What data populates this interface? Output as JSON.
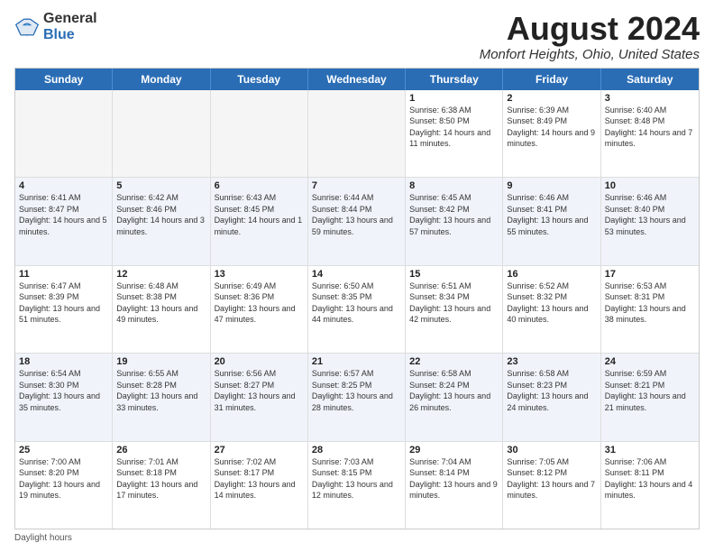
{
  "header": {
    "logo_general": "General",
    "logo_blue": "Blue",
    "month_title": "August 2024",
    "location": "Monfort Heights, Ohio, United States"
  },
  "days_of_week": [
    "Sunday",
    "Monday",
    "Tuesday",
    "Wednesday",
    "Thursday",
    "Friday",
    "Saturday"
  ],
  "weeks": [
    [
      {
        "day": "",
        "sunrise": "",
        "sunset": "",
        "daylight": "",
        "empty": true
      },
      {
        "day": "",
        "sunrise": "",
        "sunset": "",
        "daylight": "",
        "empty": true
      },
      {
        "day": "",
        "sunrise": "",
        "sunset": "",
        "daylight": "",
        "empty": true
      },
      {
        "day": "",
        "sunrise": "",
        "sunset": "",
        "daylight": "",
        "empty": true
      },
      {
        "day": "1",
        "sunrise": "Sunrise: 6:38 AM",
        "sunset": "Sunset: 8:50 PM",
        "daylight": "Daylight: 14 hours and 11 minutes.",
        "empty": false
      },
      {
        "day": "2",
        "sunrise": "Sunrise: 6:39 AM",
        "sunset": "Sunset: 8:49 PM",
        "daylight": "Daylight: 14 hours and 9 minutes.",
        "empty": false
      },
      {
        "day": "3",
        "sunrise": "Sunrise: 6:40 AM",
        "sunset": "Sunset: 8:48 PM",
        "daylight": "Daylight: 14 hours and 7 minutes.",
        "empty": false
      }
    ],
    [
      {
        "day": "4",
        "sunrise": "Sunrise: 6:41 AM",
        "sunset": "Sunset: 8:47 PM",
        "daylight": "Daylight: 14 hours and 5 minutes.",
        "empty": false
      },
      {
        "day": "5",
        "sunrise": "Sunrise: 6:42 AM",
        "sunset": "Sunset: 8:46 PM",
        "daylight": "Daylight: 14 hours and 3 minutes.",
        "empty": false
      },
      {
        "day": "6",
        "sunrise": "Sunrise: 6:43 AM",
        "sunset": "Sunset: 8:45 PM",
        "daylight": "Daylight: 14 hours and 1 minute.",
        "empty": false
      },
      {
        "day": "7",
        "sunrise": "Sunrise: 6:44 AM",
        "sunset": "Sunset: 8:44 PM",
        "daylight": "Daylight: 13 hours and 59 minutes.",
        "empty": false
      },
      {
        "day": "8",
        "sunrise": "Sunrise: 6:45 AM",
        "sunset": "Sunset: 8:42 PM",
        "daylight": "Daylight: 13 hours and 57 minutes.",
        "empty": false
      },
      {
        "day": "9",
        "sunrise": "Sunrise: 6:46 AM",
        "sunset": "Sunset: 8:41 PM",
        "daylight": "Daylight: 13 hours and 55 minutes.",
        "empty": false
      },
      {
        "day": "10",
        "sunrise": "Sunrise: 6:46 AM",
        "sunset": "Sunset: 8:40 PM",
        "daylight": "Daylight: 13 hours and 53 minutes.",
        "empty": false
      }
    ],
    [
      {
        "day": "11",
        "sunrise": "Sunrise: 6:47 AM",
        "sunset": "Sunset: 8:39 PM",
        "daylight": "Daylight: 13 hours and 51 minutes.",
        "empty": false
      },
      {
        "day": "12",
        "sunrise": "Sunrise: 6:48 AM",
        "sunset": "Sunset: 8:38 PM",
        "daylight": "Daylight: 13 hours and 49 minutes.",
        "empty": false
      },
      {
        "day": "13",
        "sunrise": "Sunrise: 6:49 AM",
        "sunset": "Sunset: 8:36 PM",
        "daylight": "Daylight: 13 hours and 47 minutes.",
        "empty": false
      },
      {
        "day": "14",
        "sunrise": "Sunrise: 6:50 AM",
        "sunset": "Sunset: 8:35 PM",
        "daylight": "Daylight: 13 hours and 44 minutes.",
        "empty": false
      },
      {
        "day": "15",
        "sunrise": "Sunrise: 6:51 AM",
        "sunset": "Sunset: 8:34 PM",
        "daylight": "Daylight: 13 hours and 42 minutes.",
        "empty": false
      },
      {
        "day": "16",
        "sunrise": "Sunrise: 6:52 AM",
        "sunset": "Sunset: 8:32 PM",
        "daylight": "Daylight: 13 hours and 40 minutes.",
        "empty": false
      },
      {
        "day": "17",
        "sunrise": "Sunrise: 6:53 AM",
        "sunset": "Sunset: 8:31 PM",
        "daylight": "Daylight: 13 hours and 38 minutes.",
        "empty": false
      }
    ],
    [
      {
        "day": "18",
        "sunrise": "Sunrise: 6:54 AM",
        "sunset": "Sunset: 8:30 PM",
        "daylight": "Daylight: 13 hours and 35 minutes.",
        "empty": false
      },
      {
        "day": "19",
        "sunrise": "Sunrise: 6:55 AM",
        "sunset": "Sunset: 8:28 PM",
        "daylight": "Daylight: 13 hours and 33 minutes.",
        "empty": false
      },
      {
        "day": "20",
        "sunrise": "Sunrise: 6:56 AM",
        "sunset": "Sunset: 8:27 PM",
        "daylight": "Daylight: 13 hours and 31 minutes.",
        "empty": false
      },
      {
        "day": "21",
        "sunrise": "Sunrise: 6:57 AM",
        "sunset": "Sunset: 8:25 PM",
        "daylight": "Daylight: 13 hours and 28 minutes.",
        "empty": false
      },
      {
        "day": "22",
        "sunrise": "Sunrise: 6:58 AM",
        "sunset": "Sunset: 8:24 PM",
        "daylight": "Daylight: 13 hours and 26 minutes.",
        "empty": false
      },
      {
        "day": "23",
        "sunrise": "Sunrise: 6:58 AM",
        "sunset": "Sunset: 8:23 PM",
        "daylight": "Daylight: 13 hours and 24 minutes.",
        "empty": false
      },
      {
        "day": "24",
        "sunrise": "Sunrise: 6:59 AM",
        "sunset": "Sunset: 8:21 PM",
        "daylight": "Daylight: 13 hours and 21 minutes.",
        "empty": false
      }
    ],
    [
      {
        "day": "25",
        "sunrise": "Sunrise: 7:00 AM",
        "sunset": "Sunset: 8:20 PM",
        "daylight": "Daylight: 13 hours and 19 minutes.",
        "empty": false
      },
      {
        "day": "26",
        "sunrise": "Sunrise: 7:01 AM",
        "sunset": "Sunset: 8:18 PM",
        "daylight": "Daylight: 13 hours and 17 minutes.",
        "empty": false
      },
      {
        "day": "27",
        "sunrise": "Sunrise: 7:02 AM",
        "sunset": "Sunset: 8:17 PM",
        "daylight": "Daylight: 13 hours and 14 minutes.",
        "empty": false
      },
      {
        "day": "28",
        "sunrise": "Sunrise: 7:03 AM",
        "sunset": "Sunset: 8:15 PM",
        "daylight": "Daylight: 13 hours and 12 minutes.",
        "empty": false
      },
      {
        "day": "29",
        "sunrise": "Sunrise: 7:04 AM",
        "sunset": "Sunset: 8:14 PM",
        "daylight": "Daylight: 13 hours and 9 minutes.",
        "empty": false
      },
      {
        "day": "30",
        "sunrise": "Sunrise: 7:05 AM",
        "sunset": "Sunset: 8:12 PM",
        "daylight": "Daylight: 13 hours and 7 minutes.",
        "empty": false
      },
      {
        "day": "31",
        "sunrise": "Sunrise: 7:06 AM",
        "sunset": "Sunset: 8:11 PM",
        "daylight": "Daylight: 13 hours and 4 minutes.",
        "empty": false
      }
    ]
  ],
  "footer": {
    "daylight_label": "Daylight hours"
  }
}
